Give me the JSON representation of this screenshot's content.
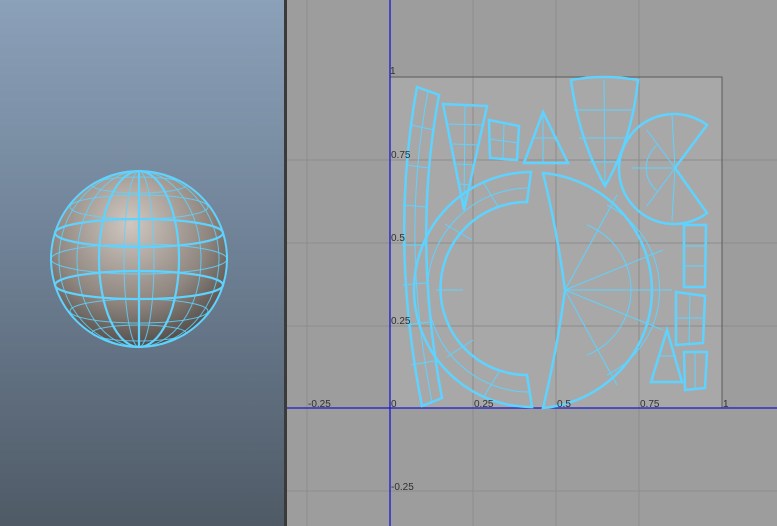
{
  "viewport": {
    "object_icon": "sphere-wireframe-icon"
  },
  "uv_editor": {
    "labels": {
      "top_one": "1",
      "v_075": "0.75",
      "v_05": "0.5",
      "v_025": "0.25",
      "neg_u": "-0.25",
      "zero": "0",
      "u_025": "0.25",
      "u_05": "0.5",
      "u_075": "0.75",
      "u_1": "1",
      "neg_v": "-0.25"
    },
    "colors": {
      "wire": "#5fd3ff",
      "axis": "#1a1acc",
      "grid": "#8d8d8d",
      "background": "#9d9d9d",
      "uv_tile": "#a8a8a8"
    }
  }
}
